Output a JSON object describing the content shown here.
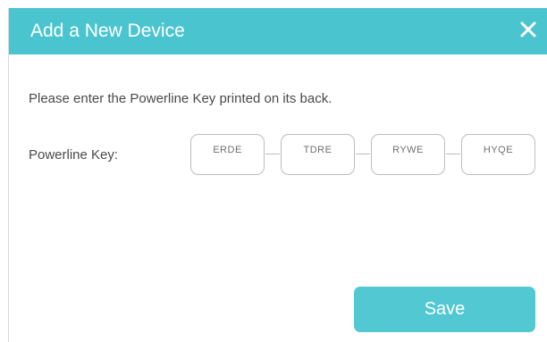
{
  "dialog": {
    "title": "Add a New Device",
    "close_icon": "close-icon",
    "instruction": "Please enter the Powerline Key printed on its back.",
    "key_label": "Powerline Key:",
    "key_segments": [
      "ERDE",
      "TDRE",
      "RYWE",
      "HYQE"
    ],
    "save_label": "Save"
  },
  "colors": {
    "header": "#4ac5cf",
    "button": "#52c8d2",
    "text": "#4a4a4a",
    "field_border": "#bdbdbd"
  }
}
